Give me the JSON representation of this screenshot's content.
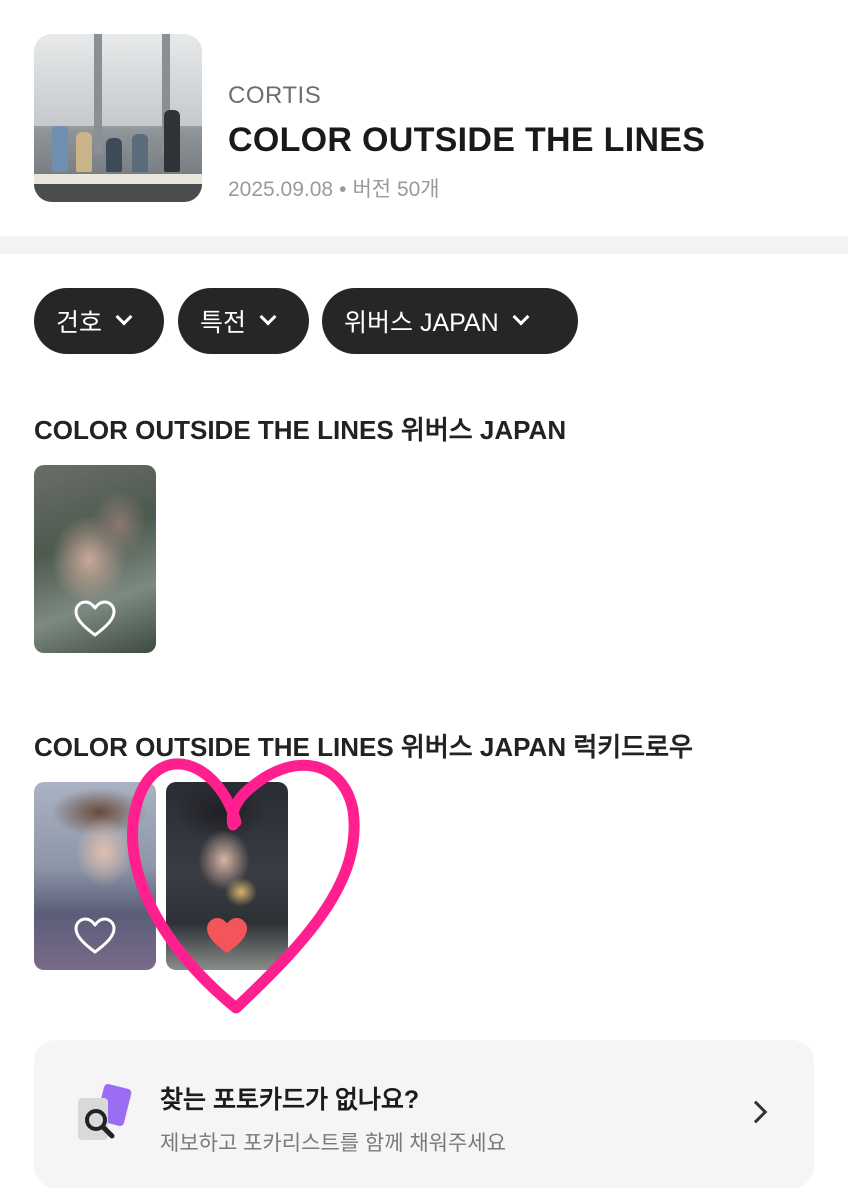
{
  "album": {
    "artist": "CORTIS",
    "title": "COLOR OUTSIDE THE LINES",
    "date": "2025.09.08",
    "separator": "•",
    "versions": "버전 50개"
  },
  "filters": [
    {
      "label": "건호",
      "icon": "chevron-down-icon"
    },
    {
      "label": "특전",
      "icon": "chevron-down-icon"
    },
    {
      "label": "위버스 JAPAN",
      "icon": "chevron-down-icon"
    }
  ],
  "sections": [
    {
      "title": "COLOR OUTSIDE THE LINES 위버스 JAPAN",
      "cards": [
        {
          "liked": false,
          "icon": "heart-outline-icon"
        }
      ]
    },
    {
      "title": "COLOR OUTSIDE THE LINES 위버스 JAPAN 럭키드로우",
      "cards": [
        {
          "liked": false,
          "icon": "heart-outline-icon"
        },
        {
          "liked": true,
          "icon": "heart-filled-icon"
        }
      ]
    }
  ],
  "request_banner": {
    "title": "찾는 포토카드가 없나요?",
    "subtitle": "제보하고 포카리스트를 함께 채워주세요",
    "icon": "search-card-icon",
    "action_icon": "chevron-right-icon"
  },
  "colors": {
    "chip_bg": "#262626",
    "liked_heart": "#f2555a",
    "doodle_pink": "#ff1f8e",
    "banner_bg": "#f5f5f5",
    "icon_purple": "#9b6df2"
  }
}
